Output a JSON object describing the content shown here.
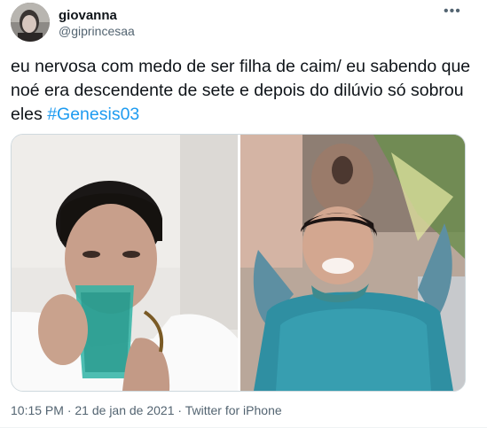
{
  "author": {
    "name": "giovanna",
    "handle": "@giprincesaa"
  },
  "menu_icon": "more-horizontal-icon",
  "tweet": {
    "text_before_hashtag": "eu nervosa com medo de ser filha de caim/ eu sabendo que noé era descendente de sete e depois do dilúvio só sobrou eles ",
    "hashtag": "#Genesis03"
  },
  "footer": {
    "time": "10:15 PM",
    "separator": " · ",
    "date": "21 de jan de 2021",
    "source": "Twitter for iPhone"
  },
  "colors": {
    "accent": "#1d9bf0",
    "secondary_text": "#536471",
    "border": "#cfd9de"
  }
}
